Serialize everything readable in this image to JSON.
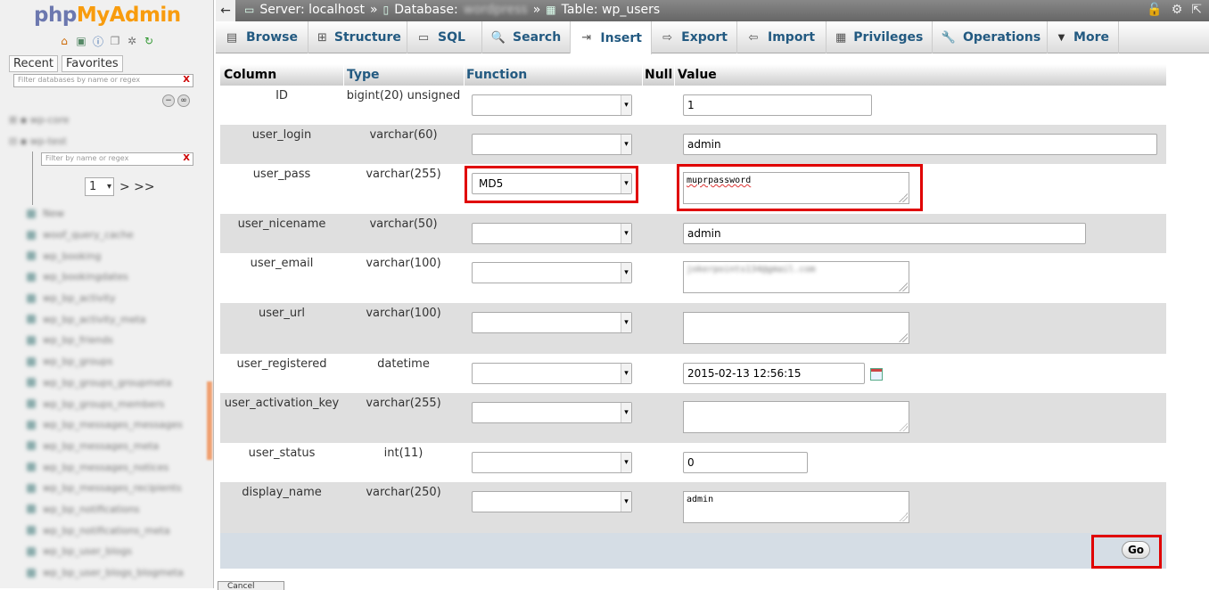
{
  "nav": {
    "logo_php": "php",
    "logo_myadmin": "MyAdmin",
    "icons": [
      "home-icon",
      "exit-icon",
      "help-icon",
      "docs-icon",
      "settings-icon",
      "reload-icon"
    ],
    "recent_label": "Recent",
    "favorites_label": "Favorites",
    "db_filter_placeholder": "Filter databases by name or regex",
    "table_filter_placeholder": "Filter by name or regex",
    "clear_label": "X",
    "databases": [
      "wp-core",
      "wp-test"
    ],
    "page_value": "1",
    "page_arrows": "> >>",
    "new_label": "New",
    "tables": [
      "woof_query_cache",
      "wp_booking",
      "wp_bookingdates",
      "wp_bp_activity",
      "wp_bp_activity_meta",
      "wp_bp_friends",
      "wp_bp_groups",
      "wp_bp_groups_groupmeta",
      "wp_bp_groups_members",
      "wp_bp_messages_messages",
      "wp_bp_messages_meta",
      "wp_bp_messages_notices",
      "wp_bp_messages_recipients",
      "wp_bp_notifications",
      "wp_bp_notifications_meta",
      "wp_bp_user_blogs",
      "wp_bp_user_blogs_blogmeta"
    ]
  },
  "topbar": {
    "back": "←",
    "server": "Server: localhost",
    "sep": "»",
    "database": "Database:",
    "database_name": "wordpress",
    "table": "Table: wp_users",
    "right_icons": [
      "lock-icon",
      "gear-icon",
      "collapse-icon"
    ]
  },
  "menu": [
    {
      "label": "Browse",
      "icon": "▤"
    },
    {
      "label": "Structure",
      "icon": "⊞"
    },
    {
      "label": "SQL",
      "icon": "▭"
    },
    {
      "label": "Search",
      "icon": "🔍"
    },
    {
      "label": "Insert",
      "icon": "⇥"
    },
    {
      "label": "Export",
      "icon": "⇨"
    },
    {
      "label": "Import",
      "icon": "⇦"
    },
    {
      "label": "Privileges",
      "icon": "▦"
    },
    {
      "label": "Operations",
      "icon": "🔧"
    },
    {
      "label": "More",
      "icon": "▼"
    }
  ],
  "form": {
    "headers": {
      "column": "Column",
      "type": "Type",
      "function": "Function",
      "null": "Null",
      "value": "Value"
    },
    "rows": [
      {
        "column": "ID",
        "type": "bigint(20) unsigned",
        "function": "",
        "value": "1"
      },
      {
        "column": "user_login",
        "type": "varchar(60)",
        "function": "",
        "value": "admin"
      },
      {
        "column": "user_pass",
        "type": "varchar(255)",
        "function": "MD5",
        "value": "muprpassword"
      },
      {
        "column": "user_nicename",
        "type": "varchar(50)",
        "function": "",
        "value": "admin"
      },
      {
        "column": "user_email",
        "type": "varchar(100)",
        "function": "",
        "value": "jokerpoints134@gmail.com"
      },
      {
        "column": "user_url",
        "type": "varchar(100)",
        "function": "",
        "value": ""
      },
      {
        "column": "user_registered",
        "type": "datetime",
        "function": "",
        "value": "2015-02-13 12:56:15"
      },
      {
        "column": "user_activation_key",
        "type": "varchar(255)",
        "function": "",
        "value": ""
      },
      {
        "column": "user_status",
        "type": "int(11)",
        "function": "",
        "value": "0"
      },
      {
        "column": "display_name",
        "type": "varchar(250)",
        "function": "",
        "value": "admin"
      }
    ],
    "go_label": "Go",
    "bottom_tab": "Cancel"
  },
  "colors": {
    "highlight": "#e00000",
    "link": "#235a81",
    "logo_blue": "#6c78af",
    "logo_orange": "#f89c0e"
  }
}
